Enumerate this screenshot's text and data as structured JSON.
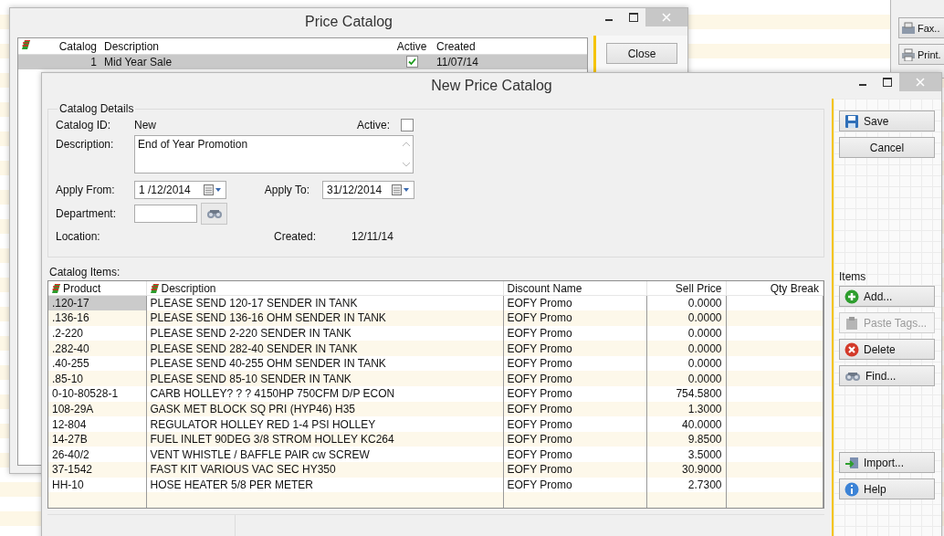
{
  "back_window": {
    "title": "Price Catalog",
    "columns": [
      "Catalog",
      "Description",
      "Active",
      "Created"
    ],
    "rows": [
      {
        "catalog": "1",
        "description": "Mid Year Sale",
        "active": true,
        "created": "11/07/14",
        "selected": true
      }
    ],
    "close_button": "Close"
  },
  "side_window": {
    "buttons": [
      "Fax..",
      "Print."
    ]
  },
  "window": {
    "title": "New Price Catalog",
    "details": {
      "group_title": "Catalog Details",
      "catalog_id_label": "Catalog ID:",
      "catalog_id": "New",
      "active_label": "Active:",
      "active": false,
      "description_label": "Description:",
      "description": "End of Year Promotion",
      "apply_from_label": "Apply From:",
      "apply_from": "1 /12/2014",
      "apply_to_label": "Apply To:",
      "apply_to": "31/12/2014",
      "department_label": "Department:",
      "location_label": "Location:",
      "created_label": "Created:",
      "created": "12/11/14"
    },
    "items_label": "Catalog Items:",
    "table": {
      "columns": [
        "Product",
        "Description",
        "Discount Name",
        "Sell Price",
        "Qty Break"
      ],
      "rows": [
        {
          "product": ".120-17",
          "description": "PLEASE SEND 120-17 SENDER IN TANK",
          "discount": "EOFY Promo",
          "sell_price": "0.0000",
          "selected": true
        },
        {
          "product": ".136-16",
          "description": "PLEASE SEND 136-16 OHM SENDER IN TANK",
          "discount": "EOFY Promo",
          "sell_price": "0.0000",
          "selected": false
        },
        {
          "product": ".2-220",
          "description": "PLEASE SEND 2-220 SENDER IN TANK",
          "discount": "EOFY Promo",
          "sell_price": "0.0000",
          "selected": false
        },
        {
          "product": ".282-40",
          "description": "PLEASE SEND 282-40 SENDER IN TANK",
          "discount": "EOFY Promo",
          "sell_price": "0.0000",
          "selected": false
        },
        {
          "product": ".40-255",
          "description": "PLEASE SEND 40-255 OHM SENDER IN TANK",
          "discount": "EOFY Promo",
          "sell_price": "0.0000",
          "selected": false
        },
        {
          "product": ".85-10",
          "description": "PLEASE SEND 85-10 SENDER IN TANK",
          "discount": "EOFY Promo",
          "sell_price": "0.0000",
          "selected": false
        },
        {
          "product": "0-10-80528-1",
          "description": "CARB HOLLEY? ? ? 4150HP 750CFM D/P ECON",
          "discount": "EOFY Promo",
          "sell_price": "754.5800",
          "selected": false
        },
        {
          "product": "108-29A",
          "description": "GASK MET BLOCK SQ PRI (HYP46) H35",
          "discount": "EOFY Promo",
          "sell_price": "1.3000",
          "selected": false
        },
        {
          "product": "12-804",
          "description": "REGULATOR HOLLEY RED 1-4 PSI HOLLEY",
          "discount": "EOFY Promo",
          "sell_price": "40.0000",
          "selected": false
        },
        {
          "product": "14-27B",
          "description": "FUEL INLET 90DEG 3/8 STROM HOLLEY KC264",
          "discount": "EOFY Promo",
          "sell_price": "9.8500",
          "selected": false
        },
        {
          "product": "26-40/2",
          "description": "VENT WHISTLE / BAFFLE PAIR cw SCREW",
          "discount": "EOFY Promo",
          "sell_price": "3.5000",
          "selected": false
        },
        {
          "product": "37-1542",
          "description": "FAST KIT VARIOUS VAC SEC HY350",
          "discount": "EOFY Promo",
          "sell_price": "30.9000",
          "selected": false
        },
        {
          "product": "HH-10",
          "description": "HOSE HEATER 5/8 PER METER",
          "discount": "EOFY Promo",
          "sell_price": "2.7300",
          "selected": false
        }
      ]
    },
    "sidebar": {
      "top_buttons": [
        {
          "label": "Save",
          "kind": "save",
          "disabled": false
        },
        {
          "label": "Cancel",
          "kind": "plain",
          "disabled": false
        }
      ],
      "items_label": "Items",
      "item_buttons": [
        {
          "label": "Add...",
          "kind": "add",
          "disabled": false
        },
        {
          "label": "Paste Tags...",
          "kind": "paste",
          "disabled": true
        },
        {
          "label": "Delete",
          "kind": "delete",
          "disabled": false
        },
        {
          "label": "Find...",
          "kind": "find",
          "disabled": false
        }
      ],
      "bottom_buttons": [
        {
          "label": "Import...",
          "kind": "import",
          "disabled": false
        },
        {
          "label": "Help",
          "kind": "help",
          "disabled": false
        }
      ]
    }
  }
}
